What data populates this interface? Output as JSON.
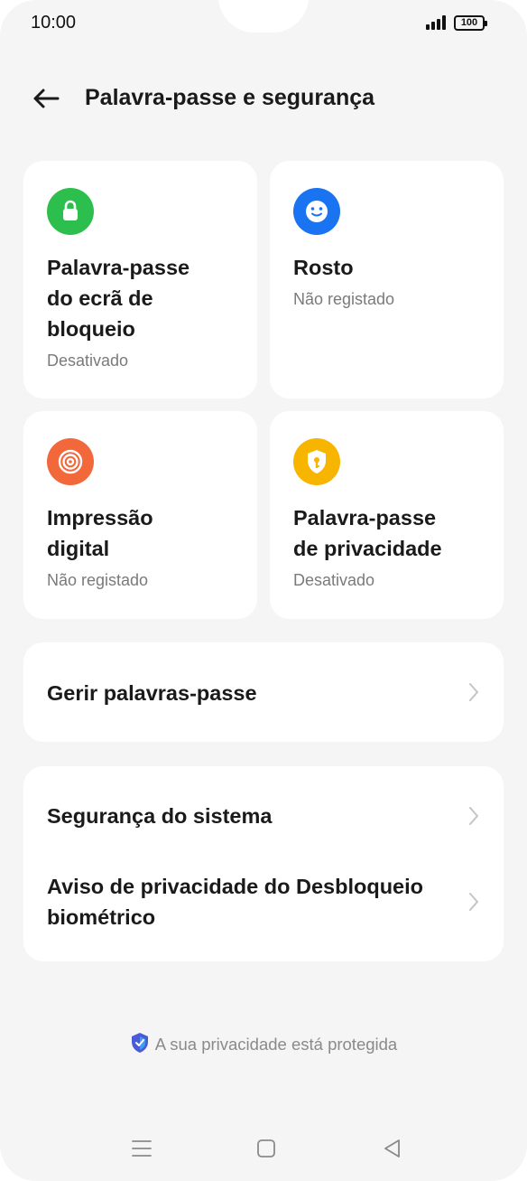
{
  "status": {
    "time": "10:00",
    "battery": "100"
  },
  "header": {
    "title": "Palavra-passe e segurança"
  },
  "tiles": [
    {
      "title": "Palavra-passe\ndo ecrã de\nbloqueio",
      "status": "Desativado",
      "icon": "lock-icon",
      "color": "#2dbf4e"
    },
    {
      "title": "Rosto",
      "status": "Não registado",
      "icon": "face-icon",
      "color": "#1a73f0"
    },
    {
      "title": "Impressão\ndigital",
      "status": "Não registado",
      "icon": "fingerprint-icon",
      "color": "#f2683a"
    },
    {
      "title": "Palavra-passe\nde privacidade",
      "status": "Desativado",
      "icon": "privacy-key-icon",
      "color": "#f7b500"
    }
  ],
  "manage": {
    "label": "Gerir palavras-passe"
  },
  "security": [
    {
      "label": "Segurança do sistema"
    },
    {
      "label": "Aviso de privacidade do Desbloqueio\nbiométrico"
    }
  ],
  "footer": {
    "privacy_text": "A sua privacidade está protegida"
  }
}
